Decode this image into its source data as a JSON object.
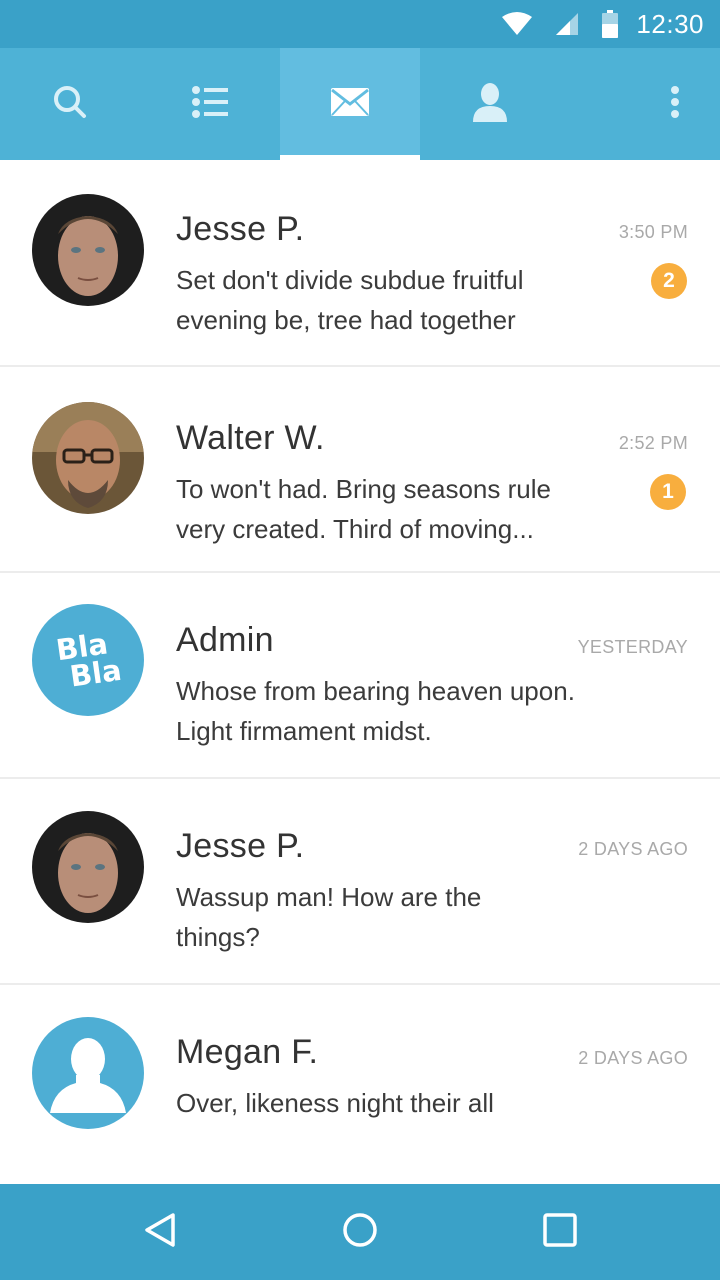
{
  "status_bar": {
    "time": "12:30",
    "icons": [
      "wifi-icon",
      "signal-icon",
      "battery-icon"
    ]
  },
  "tabs": [
    {
      "icon": "search-icon",
      "active": false
    },
    {
      "icon": "list-icon",
      "active": false
    },
    {
      "icon": "mail-icon",
      "active": true
    },
    {
      "icon": "contact-icon",
      "active": false
    }
  ],
  "overflow_icon": "more-vert-icon",
  "colors": {
    "status_bar": "#3aa1c8",
    "tab_bar": "#4eb2d6",
    "tab_active": "#62bde0",
    "badge": "#f8ae3e",
    "avatar_blue": "#4eaed4"
  },
  "messages": [
    {
      "name": "Jesse P.",
      "time": "3:50 PM",
      "preview": "Set don't divide subdue fruitful evening be, tree had together",
      "badge": "2",
      "avatar": "jesse-avatar"
    },
    {
      "name": "Walter W.",
      "time": "2:52 PM",
      "preview": "To won't had. Bring seasons rule very created. Third of moving...",
      "badge": "1",
      "avatar": "walter-avatar"
    },
    {
      "name": "Admin",
      "time": "YESTERDAY",
      "preview": "Whose from bearing heaven upon. Light firmament midst.",
      "badge": null,
      "avatar": "blabla-logo",
      "avatar_text_1": "Bla",
      "avatar_text_2": "Bla"
    },
    {
      "name": "Jesse P.",
      "time": "2 DAYS AGO",
      "preview": "Wassup man! How are the things?",
      "badge": null,
      "avatar": "jesse-avatar"
    },
    {
      "name": "Megan F.",
      "time": "2 DAYS AGO",
      "preview": "Over, likeness night their all",
      "badge": null,
      "avatar": "person-placeholder-avatar"
    }
  ],
  "nav_bar": {
    "icons": [
      "back-icon",
      "home-icon",
      "recents-icon"
    ]
  }
}
